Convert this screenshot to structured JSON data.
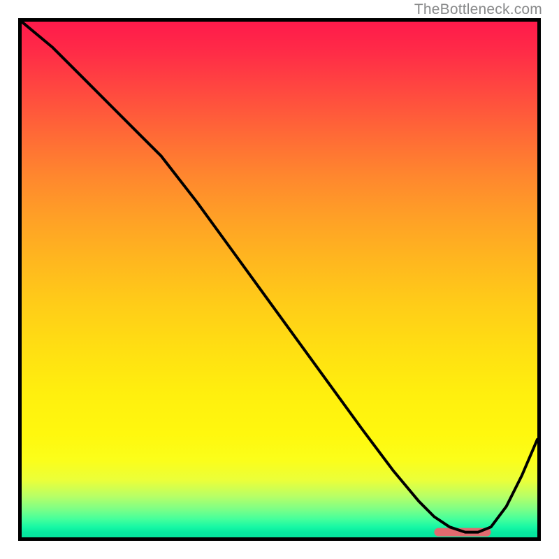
{
  "watermark": {
    "text": "TheBottleneck.com"
  },
  "chart_data": {
    "type": "line",
    "title": "",
    "xlabel": "",
    "ylabel": "",
    "xlim": [
      0,
      100
    ],
    "ylim": [
      0,
      100
    ],
    "grid": false,
    "series": [
      {
        "name": "curve",
        "x": [
          0,
          6,
          12,
          18,
          23,
          27,
          34,
          42,
          50,
          58,
          66,
          72,
          77,
          80,
          83,
          86,
          88.5,
          91,
          94,
          97,
          100
        ],
        "y": [
          100,
          95,
          89,
          83,
          78,
          74,
          65,
          54,
          43,
          32,
          21,
          13,
          7,
          4,
          2,
          1,
          1,
          2,
          6,
          12,
          19
        ]
      }
    ],
    "marker": {
      "name": "optimal-range",
      "x_start": 80,
      "x_end": 91,
      "y": 1,
      "color": "#e06a6f"
    },
    "background_gradient": {
      "top": "#ff1a4b",
      "mid": "#ffe012",
      "bottom": "#06e49d"
    }
  }
}
